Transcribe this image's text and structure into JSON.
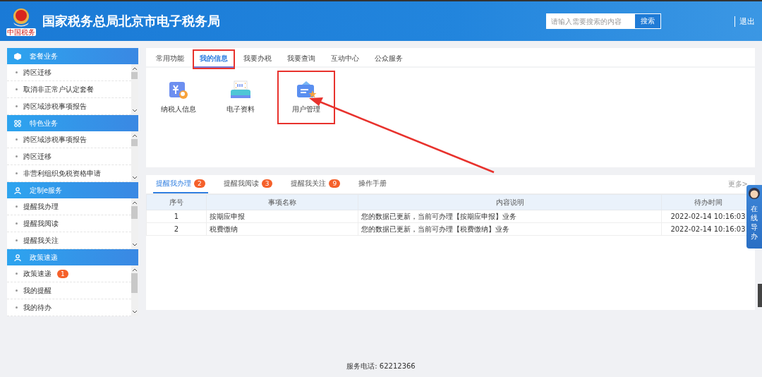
{
  "header": {
    "logo_seal": "中国税务",
    "title": "国家税务总局北京市电子税务局",
    "search": {
      "placeholder": "请输入需要搜索的内容",
      "button": "搜索"
    },
    "logout": "退出"
  },
  "sidebar": [
    {
      "title": "套餐业务",
      "kind": "package",
      "items": [
        {
          "label": "跨区迁移"
        },
        {
          "label": "取消非正常户认定套餐"
        },
        {
          "label": "跨区域涉税事项报告"
        }
      ]
    },
    {
      "title": "特色业务",
      "kind": "featured",
      "items": [
        {
          "label": "跨区域涉税事项报告"
        },
        {
          "label": "跨区迁移"
        },
        {
          "label": "非营利组织免税资格申请"
        }
      ]
    },
    {
      "title": "定制e服务",
      "kind": "custom",
      "items": [
        {
          "label": "提醒我办理"
        },
        {
          "label": "提醒我阅读"
        },
        {
          "label": "提醒我关注"
        }
      ]
    },
    {
      "title": "政策速递",
      "kind": "policy",
      "items": [
        {
          "label": "政策速递",
          "badge": "1"
        },
        {
          "label": "我的提醒"
        },
        {
          "label": "我的待办"
        }
      ]
    }
  ],
  "top_tabs": [
    {
      "label": "常用功能",
      "selected": false,
      "highlighted": false
    },
    {
      "label": "我的信息",
      "selected": true,
      "highlighted": true
    },
    {
      "label": "我要办税",
      "selected": false,
      "highlighted": false
    },
    {
      "label": "我要查询",
      "selected": false,
      "highlighted": false
    },
    {
      "label": "互动中心",
      "selected": false,
      "highlighted": false
    },
    {
      "label": "公众服务",
      "selected": false,
      "highlighted": false
    }
  ],
  "functions": [
    {
      "label": "纳税人信息",
      "kind": "taxpayer",
      "highlighted": false
    },
    {
      "label": "电子资料",
      "kind": "printer",
      "highlighted": false
    },
    {
      "label": "用户管理",
      "kind": "usercard",
      "highlighted": true
    }
  ],
  "reminder_tabs": [
    {
      "label": "提醒我办理",
      "badge": "2",
      "selected": true
    },
    {
      "label": "提醒我阅读",
      "badge": "3",
      "selected": false
    },
    {
      "label": "提醒我关注",
      "badge": "9",
      "selected": false
    },
    {
      "label": "操作手册",
      "selected": false
    }
  ],
  "more_link": "更多>",
  "table": {
    "columns": [
      "序号",
      "事项名称",
      "内容说明",
      "待办时间"
    ],
    "rows": [
      [
        "1",
        "按期应申报",
        "您的数据已更新，当前可办理【按期应申报】业务",
        "2022-02-14 10:16:03"
      ],
      [
        "2",
        "税费缴纳",
        "您的数据已更新，当前可办理【税费缴纳】业务",
        "2022-02-14 10:16:03"
      ]
    ]
  },
  "online_guide": "在线导办",
  "footer": "服务电话: 62212366"
}
